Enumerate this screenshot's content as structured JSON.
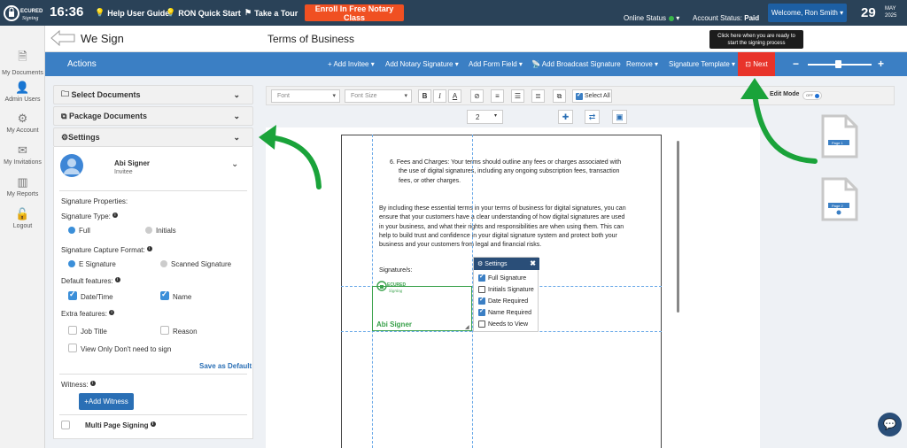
{
  "topbar": {
    "clock": "16:36",
    "links": [
      "Help User Guide",
      "RON Quick Start",
      "Take a Tour"
    ],
    "enroll_label": "Enroll In Free Notary Class",
    "online_status_label": "Online Status",
    "account_status_label": "Account Status:",
    "account_status_value": "Paid",
    "welcome_label": "Welcome,  Ron Smith",
    "day": "29",
    "month": "MAY",
    "year": "2025"
  },
  "sidebar": {
    "items": [
      {
        "label": "My Documents",
        "icon": "document-icon"
      },
      {
        "label": "Admin Users",
        "icon": "user-icon"
      },
      {
        "label": "My Account",
        "icon": "gear-icon"
      },
      {
        "label": "My Invitations",
        "icon": "envelope-icon"
      },
      {
        "label": "My Reports",
        "icon": "bar-chart-icon"
      },
      {
        "label": "Logout",
        "icon": "lock-icon"
      }
    ]
  },
  "header": {
    "app_name": "We Sign",
    "doc_title": "Terms of Business",
    "tooltip_line1": "Click here when you are ready to",
    "tooltip_line2": "start the signing process"
  },
  "actionbar": {
    "label": "Actions",
    "items": [
      "+ Add Invitee",
      "Add Notary Signature",
      "Add Form Field",
      "Add Broadcast Signature",
      "Remove",
      "Signature Template"
    ],
    "next_label": "Next"
  },
  "leftpanel": {
    "select_documents": "Select Documents",
    "package_documents": "Package Documents",
    "settings": "Settings",
    "signer_name": "Abi Signer",
    "signer_role": "Invitee",
    "signature_properties": "Signature Properties:",
    "signature_type": "Signature Type:",
    "type_full": "Full",
    "type_initials": "Initials",
    "capture_format": "Signature Capture Format:",
    "format_e": "E Signature",
    "format_scanned": "Scanned Signature",
    "default_features": "Default features:",
    "date_time": "Date/Time",
    "name": "Name",
    "extra_features": "Extra features:",
    "job_title": "Job Title",
    "reason": "Reason",
    "view_only": "View Only Don't need to sign",
    "save_default": "Save as Default",
    "witness": "Witness:",
    "add_witness": "+Add Witness",
    "multi_page": "Multi Page Signing"
  },
  "editor": {
    "font_placeholder": "Font",
    "font_size_placeholder": "Font Size",
    "select_all": "Select All",
    "edit_mode": "Edit Mode",
    "toggle_state": "OFF",
    "page_number": "2"
  },
  "document": {
    "item6_line1": "6.   Fees and Charges: Your terms should outline any fees or charges associated with",
    "item6_line2": "the use of digital signatures, including any ongoing subscription fees, transaction",
    "item6_line3": "fees, or other charges.",
    "p_line1": "By including these essential terms in your terms of business for digital signatures, you can",
    "p_line2": "ensure that your customers have a clear understanding of how digital signatures are used",
    "p_line3": "in your business, and what their rights and responsibilities are when using them. This can",
    "p_line4": "help to build trust and confidence in your digital signature system and protect both your",
    "p_line5": "business and your customers from legal and financial risks.",
    "signatures_label": "Signature/s:",
    "signer_in_box": "Abi Signer"
  },
  "float_settings": {
    "title": "Settings",
    "items": [
      {
        "label": "Full Signature",
        "checked": true
      },
      {
        "label": "Initials Signature",
        "checked": false
      },
      {
        "label": "Date Required",
        "checked": true
      },
      {
        "label": "Name Required",
        "checked": true
      },
      {
        "label": "Needs to View",
        "checked": false
      }
    ]
  },
  "thumbnails": [
    "Page 1",
    "Page 2"
  ],
  "colors": {
    "topbar": "#2a4258",
    "actionbar": "#3b7fc4",
    "next": "#e8332a",
    "enroll": "#f05022",
    "green": "#39a14b"
  }
}
